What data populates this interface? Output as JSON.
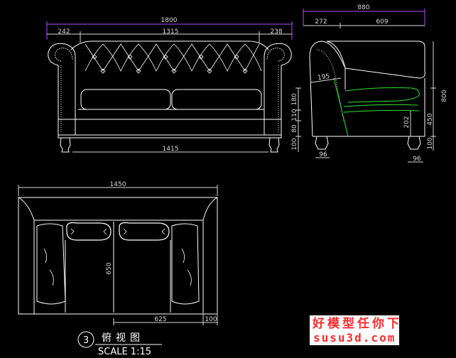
{
  "colors": {
    "background": "#000000",
    "outline": "#ffffff",
    "dimension": "#d8d8d8",
    "overall_dimension": "#b44cff",
    "seat_highlight": "#2fe62f",
    "watermark": "#ff2a2a",
    "watermark_bg": "#ffffff"
  },
  "front_view": {
    "overall_width": "1800",
    "left_arm_width": "242",
    "middle_width": "1315",
    "right_arm_width": "238",
    "inner_width": "1415",
    "height_dims": [
      "180",
      "110",
      "80",
      "100"
    ]
  },
  "side_view": {
    "overall_depth": "880",
    "back_depth": "272",
    "seat_depth": "609",
    "back_thickness": "195",
    "overall_height": "800",
    "seat_height": "450",
    "leg_height": "100",
    "frame_height": "202",
    "front_leg_width": "96",
    "back_leg_width": "96"
  },
  "top_view": {
    "overall_width": "1450",
    "seat_depth": "650",
    "half_width": "625",
    "arm_width": "100",
    "view_number": "3",
    "view_title": "俯视图",
    "scale_text": "SCALE 1:15"
  },
  "watermark": {
    "chinese": "好模型任你下",
    "url": "susu3d.com"
  }
}
